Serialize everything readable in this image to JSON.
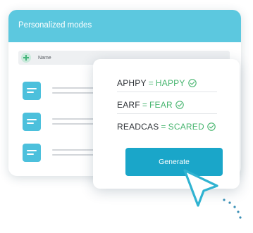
{
  "panel": {
    "title": "Personalized modes",
    "list_header": "Name",
    "header_color": "#5cc8df",
    "item_color": "#4cc0dc",
    "item_icon": "list-icon"
  },
  "card": {
    "pairs": [
      {
        "scrambled": "APHPY",
        "equals": "=",
        "word": "HAPPY",
        "icon": "check-circle-icon"
      },
      {
        "scrambled": "EARF",
        "equals": "=",
        "word": "FEAR",
        "icon": "check-circle-icon"
      },
      {
        "scrambled": "READCAS",
        "equals": "=",
        "word": "SCARED",
        "icon": "check-circle-icon"
      }
    ],
    "generate_label": "Generate",
    "accent_color": "#1aa6c9",
    "success_color": "#47b56f"
  },
  "cursor": {
    "icon": "pointer-cursor-icon",
    "color": "#30b3d1"
  }
}
